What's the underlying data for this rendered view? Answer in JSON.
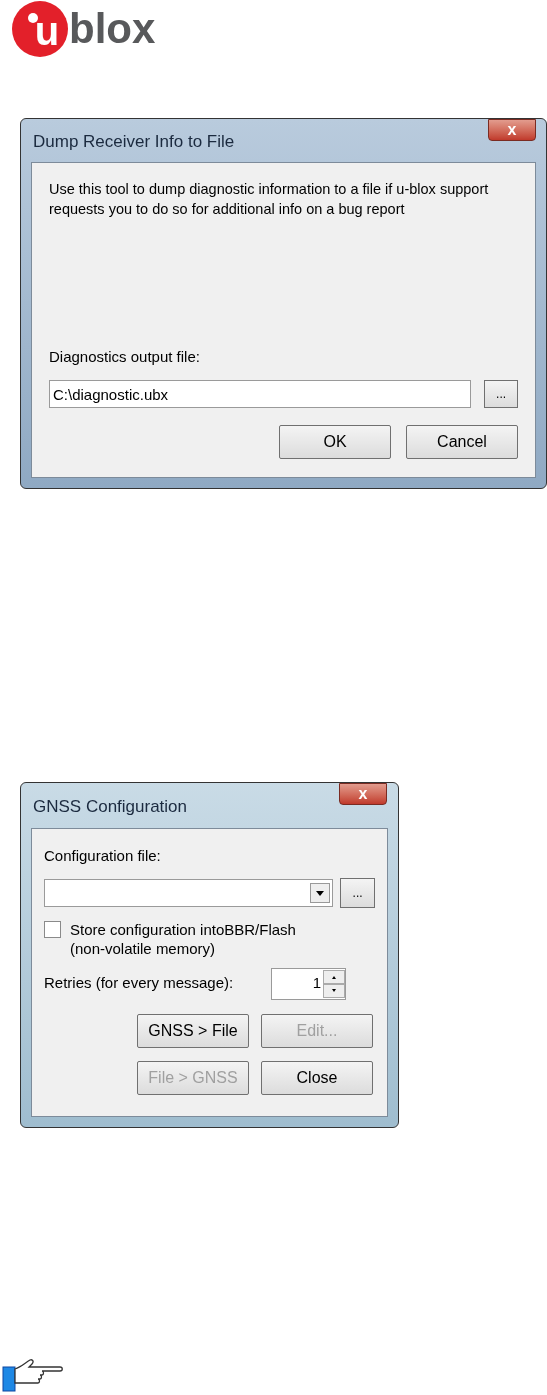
{
  "logo": {
    "mark": "u",
    "word": "blox"
  },
  "dump_dialog": {
    "title": "Dump Receiver Info to File",
    "close": "x",
    "description": "Use this tool to dump diagnostic information to a file if u-blox support requests you to do so for additional info on a bug report",
    "output_label": "Diagnostics output file:",
    "output_value": "C:\\diagnostic.ubx",
    "browse": "...",
    "buttons": [
      {
        "label": "OK",
        "disabled": false
      },
      {
        "label": "Cancel",
        "disabled": false
      }
    ]
  },
  "gnss_dialog": {
    "title": "GNSS Configuration",
    "close": "x",
    "file_label": "Configuration file:",
    "browse": "...",
    "store_checkbox": {
      "label": "Store configuration intoBBR/Flash",
      "sublabel": "(non-volatile memory)",
      "checked": false
    },
    "retries_label": "Retries (for every message):",
    "retries_value": "1",
    "buttons": [
      {
        "label": "GNSS > File",
        "disabled": false
      },
      {
        "label": "Edit...",
        "disabled": true
      },
      {
        "label": "File > GNSS",
        "disabled": true
      },
      {
        "label": "Close",
        "disabled": false
      }
    ]
  }
}
